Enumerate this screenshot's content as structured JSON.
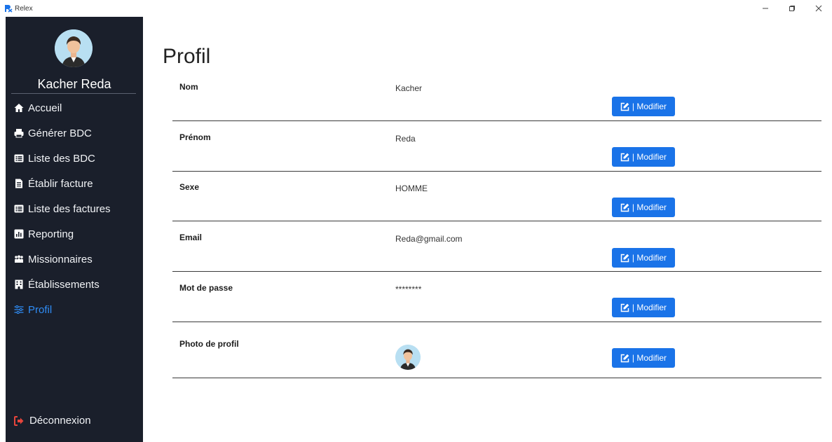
{
  "window": {
    "title": "Relex"
  },
  "sidebar": {
    "user_name": "Kacher Reda",
    "items": [
      {
        "label": "Accueil",
        "icon": "home-icon"
      },
      {
        "label": "Générer BDC",
        "icon": "print-icon"
      },
      {
        "label": "Liste des BDC",
        "icon": "list-icon"
      },
      {
        "label": "Établir facture",
        "icon": "invoice-icon"
      },
      {
        "label": "Liste des factures",
        "icon": "list-icon"
      },
      {
        "label": "Reporting",
        "icon": "chart-icon"
      },
      {
        "label": "Missionnaires",
        "icon": "users-icon"
      },
      {
        "label": "Établissements",
        "icon": "building-icon"
      },
      {
        "label": "Profil",
        "icon": "sliders-icon",
        "active": true
      }
    ],
    "logout_label": "Déconnexion"
  },
  "main": {
    "title": "Profil",
    "modify_label": "| Modifier",
    "rows": [
      {
        "label": "Nom",
        "value": "Kacher"
      },
      {
        "label": "Prénom",
        "value": "Reda"
      },
      {
        "label": "Sexe",
        "value": "HOMME"
      },
      {
        "label": "Email",
        "value": "Reda@gmail.com"
      },
      {
        "label": "Mot de passe",
        "value": "********"
      },
      {
        "label": "Photo de profil",
        "value": ""
      }
    ]
  },
  "colors": {
    "sidebar_bg": "#1a1f2b",
    "accent": "#1a73e8",
    "active": "#2f8cf5",
    "logout_icon": "#e8453c"
  }
}
